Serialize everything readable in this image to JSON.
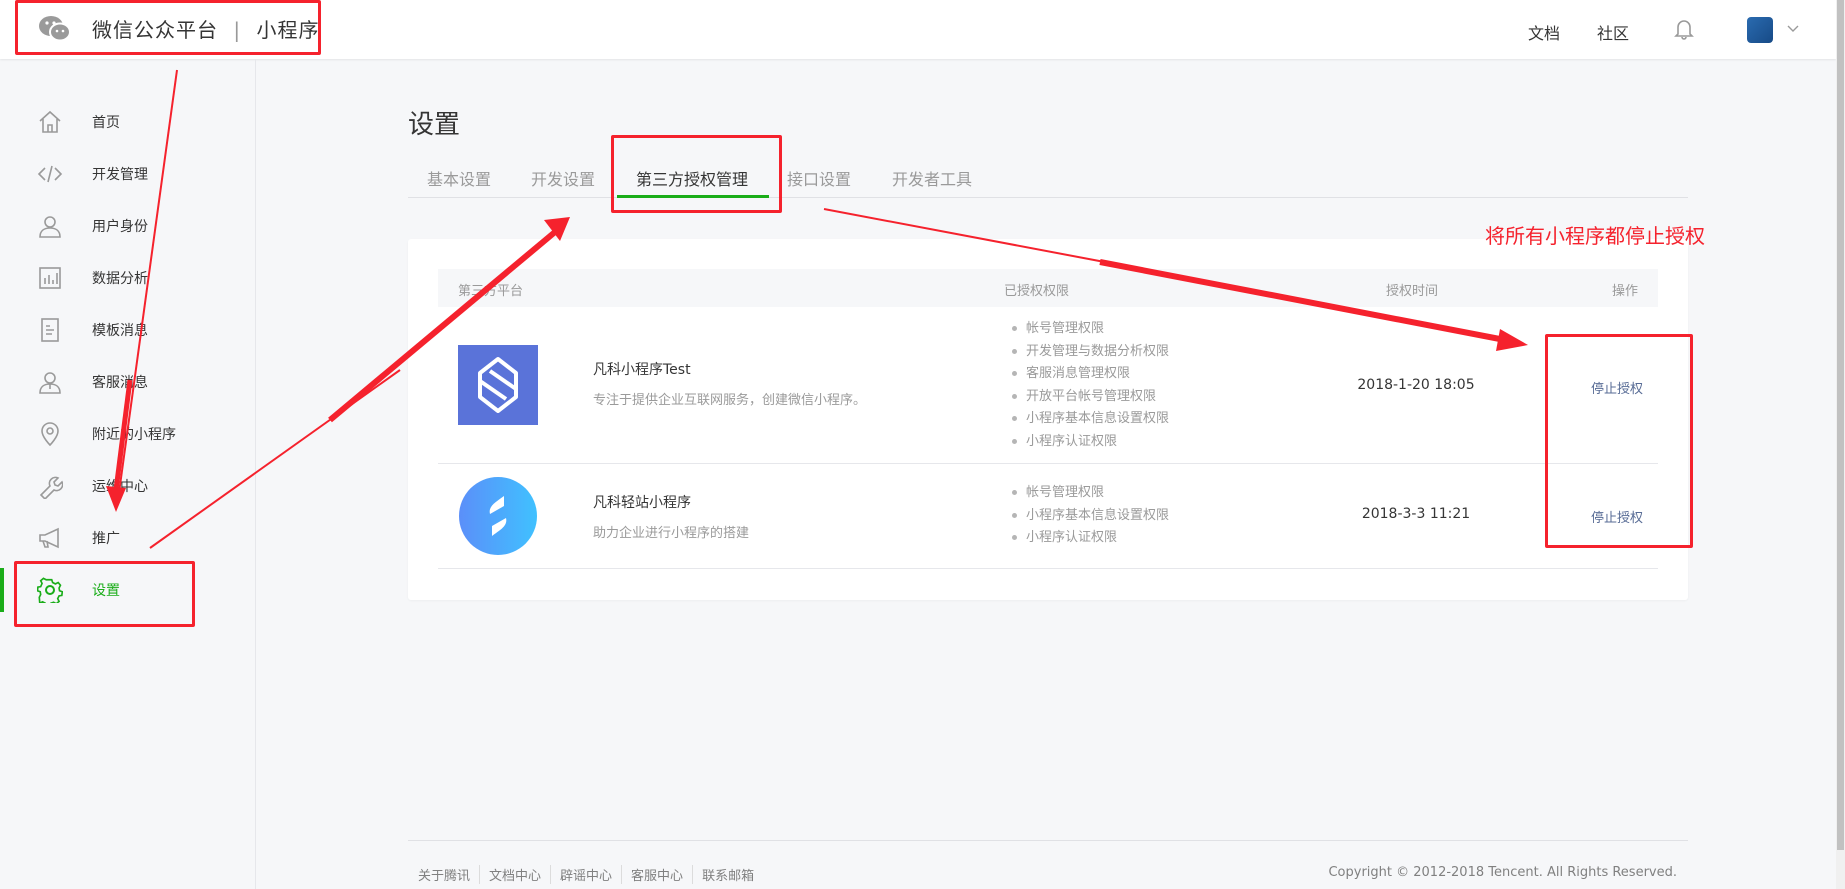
{
  "header": {
    "brand": "微信公众平台",
    "separator": "|",
    "product": "小程序",
    "nav": [
      "文档",
      "社区"
    ]
  },
  "sidebar": {
    "items": [
      {
        "label": "首页",
        "icon": "home-icon"
      },
      {
        "label": "开发管理",
        "icon": "code-icon"
      },
      {
        "label": "用户身份",
        "icon": "user-icon"
      },
      {
        "label": "数据分析",
        "icon": "chart-icon"
      },
      {
        "label": "模板消息",
        "icon": "document-icon"
      },
      {
        "label": "客服消息",
        "icon": "service-icon"
      },
      {
        "label": "附近的小程序",
        "icon": "location-icon"
      },
      {
        "label": "运维中心",
        "icon": "wrench-icon"
      },
      {
        "label": "推广",
        "icon": "megaphone-icon"
      },
      {
        "label": "设置",
        "icon": "gear-icon",
        "active": true
      }
    ]
  },
  "page": {
    "title": "设置",
    "tabs": [
      "基本设置",
      "开发设置",
      "第三方授权管理",
      "接口设置",
      "开发者工具"
    ],
    "active_tab": "第三方授权管理"
  },
  "table": {
    "headers": [
      "第三方平台",
      "已授权权限",
      "授权时间",
      "操作"
    ],
    "rows": [
      {
        "name": "凡科小程序Test",
        "desc": "专注于提供企业互联网服务，创建微信小程序。",
        "perms": [
          "帐号管理权限",
          "开发管理与数据分析权限",
          "客服消息管理权限",
          "开放平台帐号管理权限",
          "小程序基本信息设置权限",
          "小程序认证权限"
        ],
        "time": "2018-1-20 18:05",
        "action": "停止授权"
      },
      {
        "name": "凡科轻站小程序",
        "desc": "助力企业进行小程序的搭建",
        "perms": [
          "帐号管理权限",
          "小程序基本信息设置权限",
          "小程序认证权限"
        ],
        "time": "2018-3-3 11:21",
        "action": "停止授权"
      }
    ]
  },
  "footer": {
    "links": [
      "关于腾讯",
      "文档中心",
      "辟谣中心",
      "客服中心",
      "联系邮箱"
    ],
    "copyright": "Copyright © 2012-2018 Tencent. All Rights Reserved."
  },
  "annotation": {
    "note": "将所有小程序都停止授权",
    "color": "#f5222d"
  },
  "colors": {
    "accent": "#1aad19",
    "link": "#576b95"
  }
}
